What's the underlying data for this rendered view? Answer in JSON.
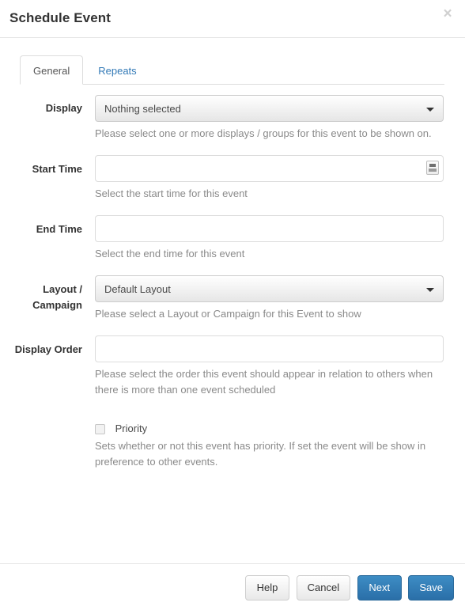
{
  "modal": {
    "title": "Schedule Event",
    "close_icon": "close-icon",
    "close_label": "×"
  },
  "tabs": [
    {
      "label": "General",
      "active": true
    },
    {
      "label": "Repeats",
      "active": false
    }
  ],
  "form": {
    "display": {
      "label": "Display",
      "control": "dropdown",
      "value": "Nothing selected",
      "help": "Please select one or more displays / groups for this event to be shown on."
    },
    "start_time": {
      "label": "Start Time",
      "control": "text",
      "value": "",
      "placeholder": "",
      "icon": "calendar-icon",
      "help": "Select the start time for this event"
    },
    "end_time": {
      "label": "End Time",
      "control": "text",
      "value": "",
      "placeholder": "",
      "help": "Select the end time for this event"
    },
    "layout_campaign": {
      "label": "Layout / Campaign",
      "control": "dropdown",
      "value": "Default Layout",
      "help": "Please select a Layout or Campaign for this Event to show"
    },
    "display_order": {
      "label": "Display Order",
      "control": "text",
      "value": "",
      "placeholder": "",
      "help": "Please select the order this event should appear in relation to others when there is more than one event scheduled"
    },
    "priority": {
      "label": "Priority",
      "control": "checkbox",
      "checked": false,
      "help": "Sets whether or not this event has priority. If set the event will be show in preference to other events."
    }
  },
  "footer": {
    "buttons": [
      {
        "label": "Help",
        "style": "default"
      },
      {
        "label": "Cancel",
        "style": "default"
      },
      {
        "label": "Next",
        "style": "primary"
      },
      {
        "label": "Save",
        "style": "primary"
      }
    ]
  },
  "colors": {
    "primary": "#2a6fa8",
    "link": "#337ab7",
    "help_text": "#8a8a8a",
    "border": "#dddddd"
  }
}
